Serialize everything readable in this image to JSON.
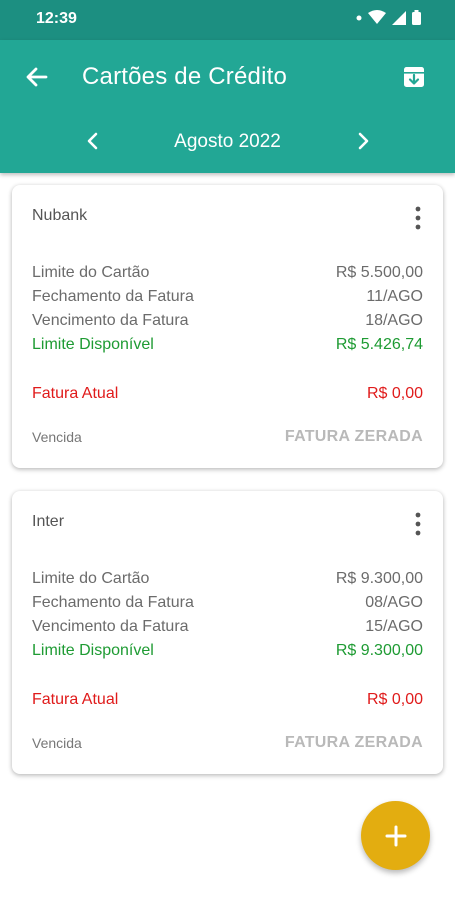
{
  "status_bar": {
    "time": "12:39"
  },
  "app_bar": {
    "title": "Cartões de Crédito",
    "month": "Agosto 2022"
  },
  "cards": [
    {
      "name": "Nubank",
      "limite_label": "Limite do Cartão",
      "limite_value": "R$ 5.500,00",
      "fechamento_label": "Fechamento da Fatura",
      "fechamento_value": "11/AGO",
      "vencimento_label": "Vencimento da Fatura",
      "vencimento_value": "18/AGO",
      "disponivel_label": "Limite Disponível",
      "disponivel_value": "R$ 5.426,74",
      "fatura_label": "Fatura Atual",
      "fatura_value": "R$ 0,00",
      "status_label": "Vencida",
      "status_value": "FATURA ZERADA"
    },
    {
      "name": "Inter",
      "limite_label": "Limite do Cartão",
      "limite_value": "R$ 9.300,00",
      "fechamento_label": "Fechamento da Fatura",
      "fechamento_value": "08/AGO",
      "vencimento_label": "Vencimento da Fatura",
      "vencimento_value": "15/AGO",
      "disponivel_label": "Limite Disponível",
      "disponivel_value": "R$ 9.300,00",
      "fatura_label": "Fatura Atual",
      "fatura_value": "R$ 0,00",
      "status_label": "Vencida",
      "status_value": "FATURA ZERADA"
    }
  ],
  "colors": {
    "status_bar": "#1c8f81",
    "app_bar": "#22a795",
    "available": "#1e9b33",
    "current_invoice": "#e01b1b",
    "fab": "#e3ad10"
  },
  "icons": {
    "back": "arrow-left-icon",
    "archive": "archive-down-icon",
    "prev": "chevron-left-icon",
    "next": "chevron-right-icon",
    "menu": "more-vertical-icon",
    "fab": "plus-icon"
  }
}
